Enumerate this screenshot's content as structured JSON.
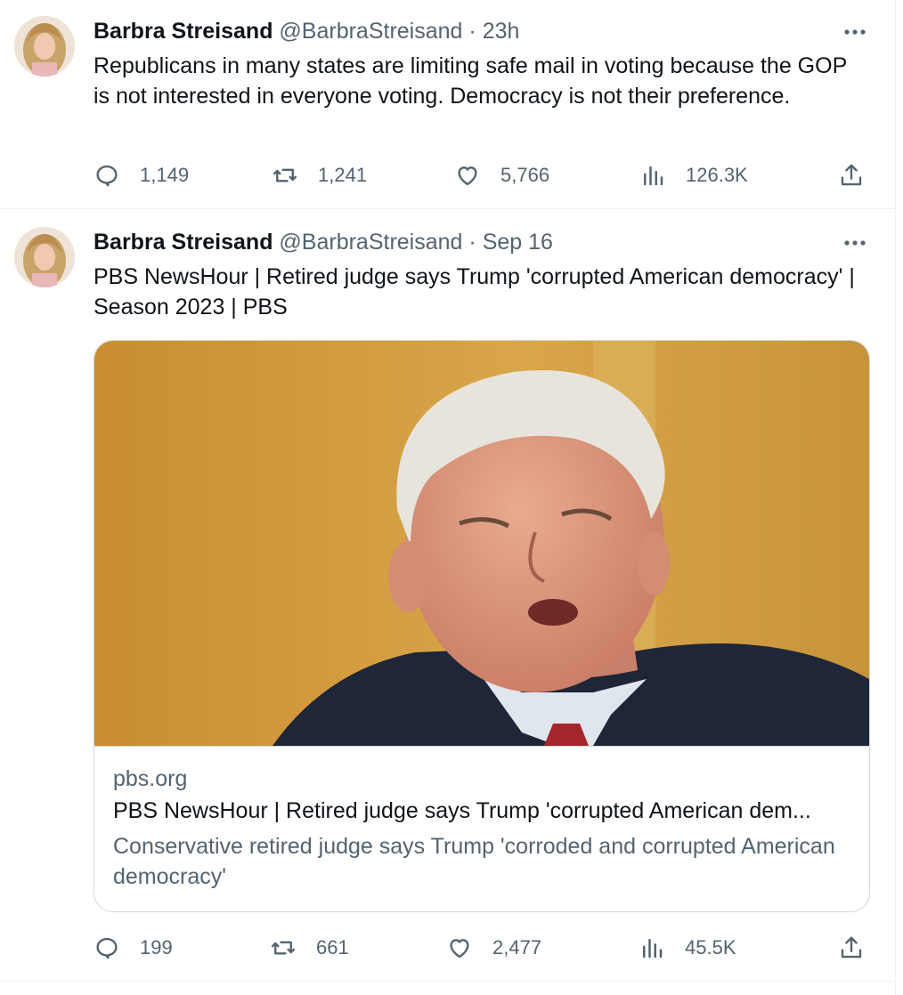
{
  "tweets": [
    {
      "author_name": "Barbra Streisand",
      "handle": "@BarbraStreisand",
      "separator": "·",
      "time": "23h",
      "text": "Republicans in many states are limiting safe mail in voting  because the GOP is not interested in everyone voting. Democracy is not their preference.",
      "replies": "1,149",
      "reposts": "1,241",
      "likes": "5,766",
      "views": "126.3K"
    },
    {
      "author_name": "Barbra Streisand",
      "handle": "@BarbraStreisand",
      "separator": "·",
      "time": "Sep 16",
      "text": "PBS NewsHour | Retired judge says Trump 'corrupted American democracy' | Season 2023 | PBS",
      "card": {
        "domain": "pbs.org",
        "title": "PBS NewsHour | Retired judge says Trump 'corrupted American dem...",
        "description": "Conservative retired judge says Trump 'corroded and corrupted American democracy'"
      },
      "replies": "199",
      "reposts": "661",
      "likes": "2,477",
      "views": "45.5K"
    }
  ],
  "icons": {
    "reply": "reply-icon",
    "repost": "repost-icon",
    "like": "heart-icon",
    "views": "views-icon",
    "share": "share-icon",
    "more": "more-icon"
  },
  "colors": {
    "text_primary": "#0f1419",
    "text_secondary": "#536471",
    "border": "#cfd9de",
    "divider": "#eff3f4"
  }
}
